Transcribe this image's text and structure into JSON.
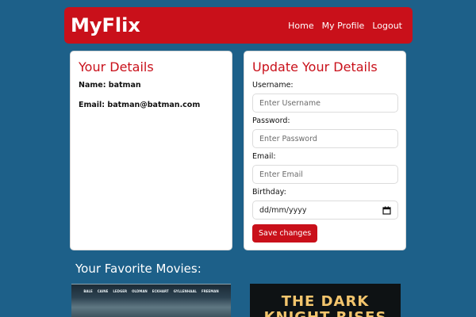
{
  "navbar": {
    "brand": "MyFlix",
    "links": [
      "Home",
      "My Profile",
      "Logout"
    ],
    "color": "#c9101a"
  },
  "details": {
    "title": "Your Details",
    "name_line": "Name: batman",
    "email_line": "Email: batman@batman.com"
  },
  "update_form": {
    "title": "Update Your Details",
    "username_label": "Username:",
    "username_placeholder": "Enter Username",
    "password_label": "Password:",
    "password_placeholder": "Enter Password",
    "email_label": "Email:",
    "email_placeholder": "Enter Email",
    "birthday_label": "Birthday:",
    "birthday_value": "dd/mm/yyyy",
    "birthday_icon": "calendar-icon",
    "save_label": "Save changes"
  },
  "favorites": {
    "heading": "Your Favorite Movies:",
    "movies": [
      {
        "credits": [
          "BALE",
          "CAINE",
          "LEDGER",
          "OLDMAN",
          "ECKHART",
          "GYLLENHAAL",
          "FREEMAN"
        ],
        "title_line_1": "",
        "title_line_2": ""
      },
      {
        "title_line_1": "THE DARK",
        "title_line_2": "KNIGHT RISES"
      }
    ]
  },
  "colors": {
    "background": "#1d6089",
    "accent": "#c9101a",
    "poster_title": "#f3c56d"
  }
}
